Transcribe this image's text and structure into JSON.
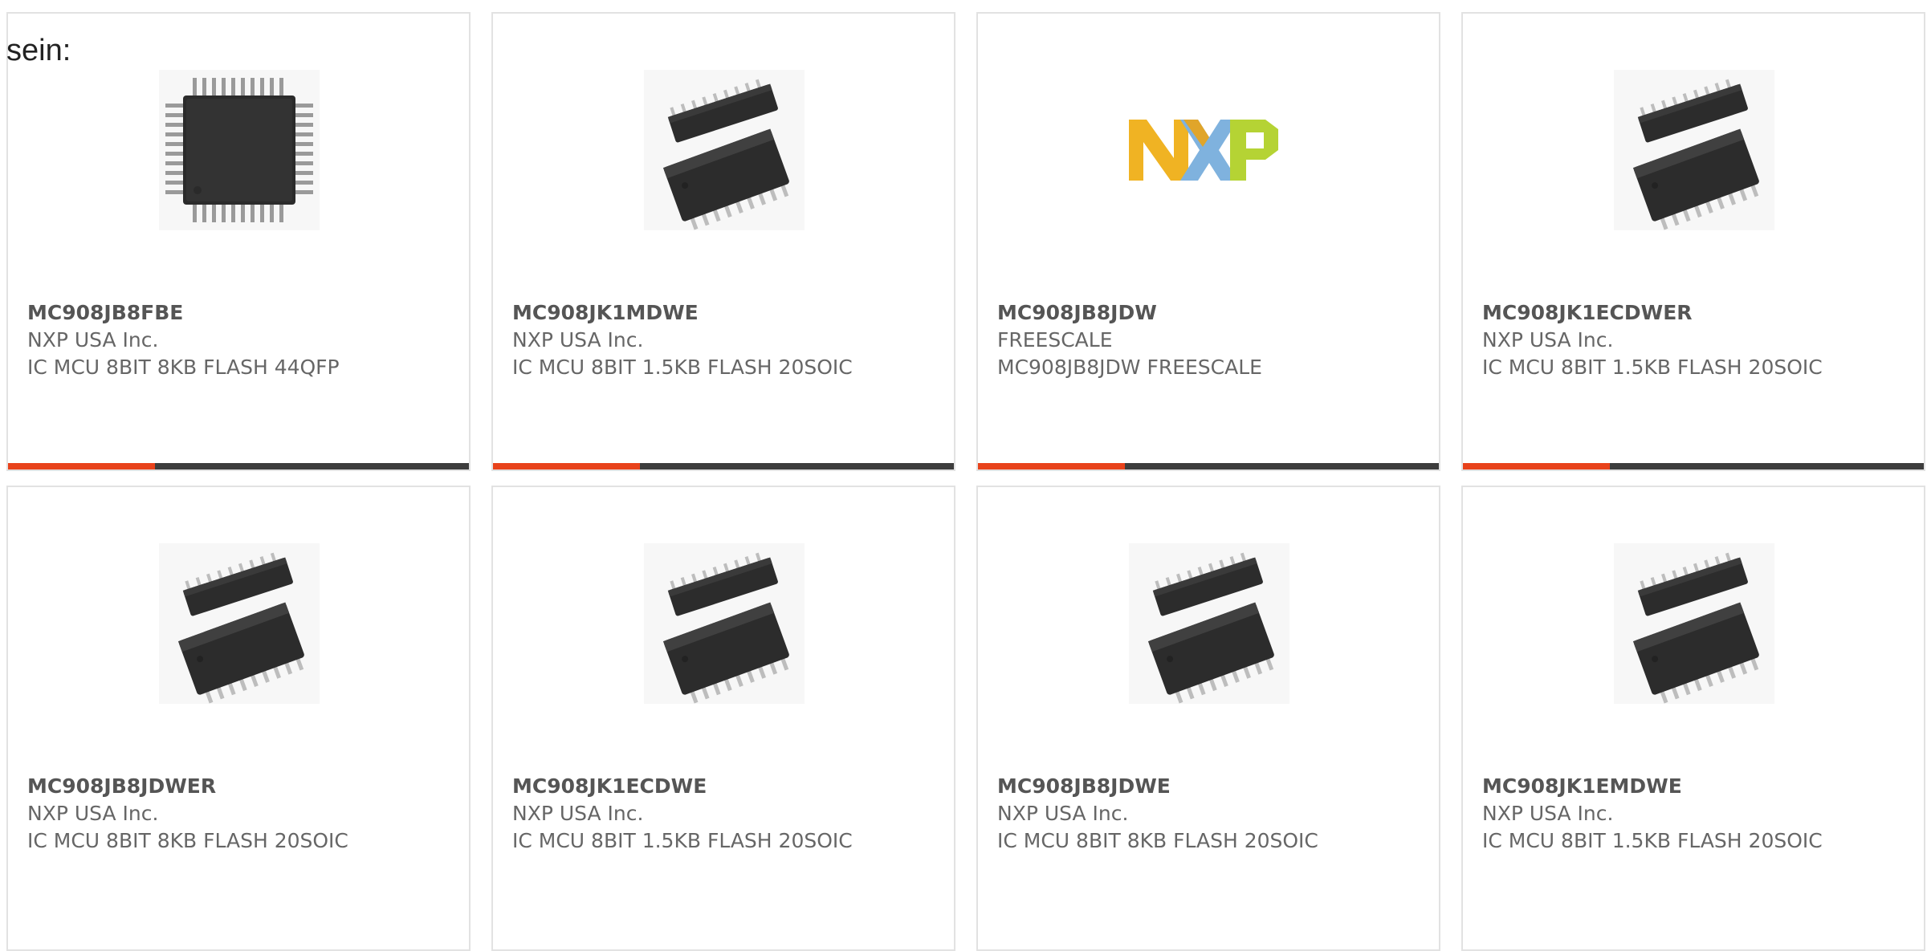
{
  "intro_text": "sein:",
  "products": [
    {
      "part": "MC908JB8FBE",
      "manufacturer": "NXP USA Inc.",
      "description": "IC MCU 8BIT 8KB FLASH 44QFP",
      "image": "qfp-chip-icon"
    },
    {
      "part": "MC908JK1MDWE",
      "manufacturer": "NXP USA Inc.",
      "description": "IC MCU 8BIT 1.5KB FLASH 20SOIC",
      "image": "soic-chip-icon"
    },
    {
      "part": "MC908JB8JDW",
      "manufacturer": "FREESCALE",
      "description": "MC908JB8JDW FREESCALE",
      "image": "nxp-logo-icon"
    },
    {
      "part": "MC908JK1ECDWER",
      "manufacturer": "NXP USA Inc.",
      "description": "IC MCU 8BIT 1.5KB FLASH 20SOIC",
      "image": "soic-chip-icon"
    },
    {
      "part": "MC908JB8JDWER",
      "manufacturer": "NXP USA Inc.",
      "description": "IC MCU 8BIT 8KB FLASH 20SOIC",
      "image": "soic-chip-icon"
    },
    {
      "part": "MC908JK1ECDWE",
      "manufacturer": "NXP USA Inc.",
      "description": "IC MCU 8BIT 1.5KB FLASH 20SOIC",
      "image": "soic-chip-icon"
    },
    {
      "part": "MC908JB8JDWE",
      "manufacturer": "NXP USA Inc.",
      "description": "IC MCU 8BIT 8KB FLASH 20SOIC",
      "image": "soic-chip-icon"
    },
    {
      "part": "MC908JK1EMDWE",
      "manufacturer": "NXP USA Inc.",
      "description": "IC MCU 8BIT 1.5KB FLASH 20SOIC",
      "image": "soic-chip-icon"
    }
  ],
  "colors": {
    "accent": "#e8421b",
    "bar_dark": "#3d3d3d",
    "card_border": "#e2e2e2",
    "text": "#666666"
  }
}
